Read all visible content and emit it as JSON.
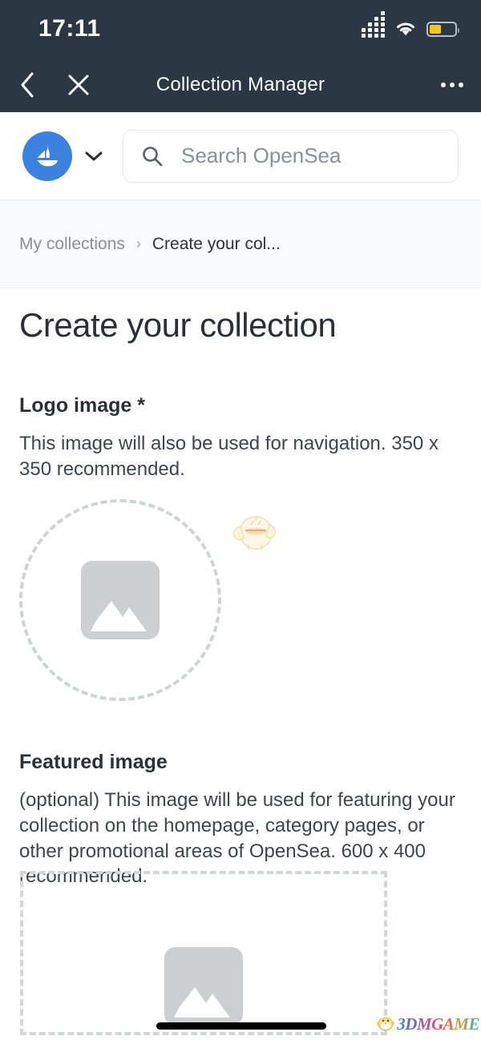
{
  "status_bar": {
    "time": "17:11",
    "signal_icon": "signal-bars-icon",
    "wifi_icon": "wifi-icon",
    "battery_icon": "battery-low-power-icon",
    "battery_color": "#f5c518",
    "background_color": "#2c3744"
  },
  "nav_bar": {
    "back_icon": "chevron-left-icon",
    "close_icon": "close-x-icon",
    "title": "Collection Manager",
    "more_icon": "more-horizontal-icon",
    "background_color": "#2c3744"
  },
  "site_header": {
    "logo_icon": "opensea-sailboat-logo-icon",
    "logo_color": "#3b82e0",
    "dropdown_icon": "chevron-down-icon",
    "search": {
      "icon": "search-icon",
      "placeholder": "Search OpenSea",
      "value": ""
    }
  },
  "breadcrumb": {
    "parent": "My collections",
    "separator": "›",
    "current": "Create your col..."
  },
  "main": {
    "page_title": "Create your collection",
    "sections": [
      {
        "title": "Logo image *",
        "description": "This image will also be used for navigation. 350 x 350 recommended.",
        "dropzone_shape": "circle",
        "dropzone_icon": "image-placeholder-icon",
        "required": true
      },
      {
        "title": "Featured image",
        "description": "(optional) This image will be used for featuring your collection on the homepage, category pages, or other promotional areas of OpenSea. 600 x 400 recommended.",
        "dropzone_shape": "rectangle",
        "dropzone_icon": "image-placeholder-icon",
        "required": false
      }
    ],
    "mascot_icon": "bird-mascot-cursor-icon"
  },
  "footer": {
    "home_indicator": "home-indicator-bar",
    "watermark_text": "3DMGAME",
    "watermark_icon": "chick-mascot-icon"
  }
}
